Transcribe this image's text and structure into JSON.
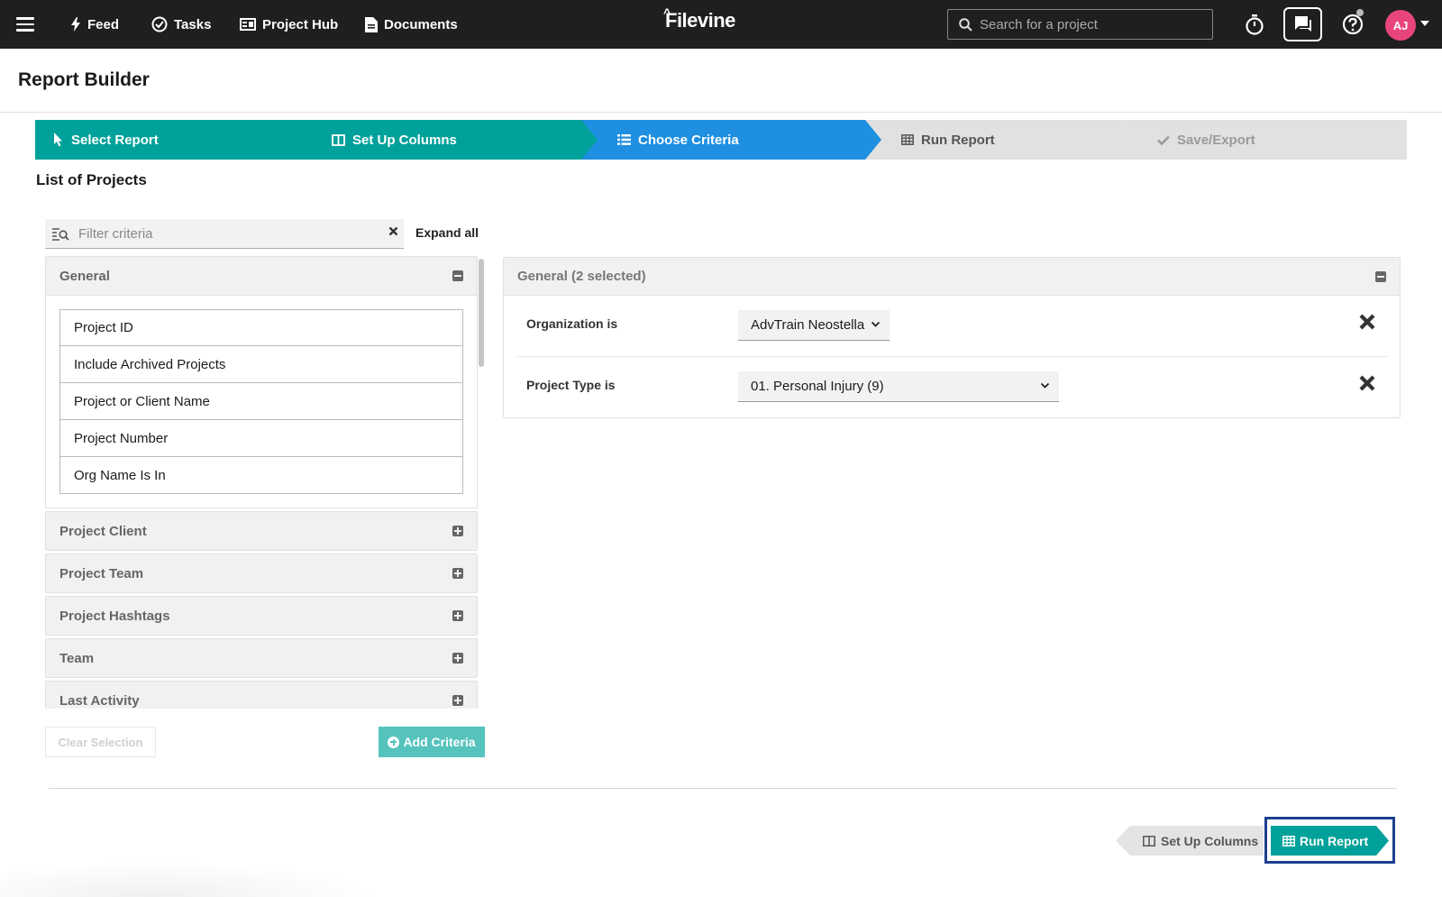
{
  "nav": {
    "items": [
      {
        "label": "Feed",
        "icon": "bolt-icon"
      },
      {
        "label": "Tasks",
        "icon": "check-circle-icon"
      },
      {
        "label": "Project Hub",
        "icon": "project-hub-icon"
      },
      {
        "label": "Documents",
        "icon": "document-icon"
      }
    ],
    "logo": "Filevine",
    "search_placeholder": "Search for a project",
    "avatar_initials": "AJ"
  },
  "page": {
    "title": "Report Builder",
    "section_title": "List of Projects"
  },
  "stepper": {
    "steps": [
      {
        "label": "Select Report",
        "state": "done",
        "icon": "pointer-icon"
      },
      {
        "label": "Set Up Columns",
        "state": "done",
        "icon": "columns-icon"
      },
      {
        "label": "Choose Criteria",
        "state": "active",
        "icon": "list-icon"
      },
      {
        "label": "Run Report",
        "state": "todo",
        "icon": "table-icon"
      },
      {
        "label": "Save/Export",
        "state": "disabled",
        "icon": "check-icon"
      }
    ]
  },
  "criteria_panel": {
    "filter_placeholder": "Filter criteria",
    "expand_all": "Expand all",
    "groups": [
      {
        "label": "General",
        "expanded": true,
        "items": [
          "Project ID",
          "Include Archived Projects",
          "Project or Client Name",
          "Project Number",
          "Org Name Is In"
        ]
      },
      {
        "label": "Project Client",
        "expanded": false
      },
      {
        "label": "Project Team",
        "expanded": false
      },
      {
        "label": "Project Hashtags",
        "expanded": false
      },
      {
        "label": "Team",
        "expanded": false
      },
      {
        "label": "Last Activity",
        "expanded": false
      }
    ],
    "clear_selection": "Clear Selection",
    "add_criteria": "Add Criteria"
  },
  "selected_panel": {
    "header": "General (2 selected)",
    "rows": [
      {
        "label": "Organization is",
        "value": "AdvTrain Neostella"
      },
      {
        "label": "Project Type is",
        "value": "01. Personal Injury (9)"
      }
    ]
  },
  "footer": {
    "back_label": "Set Up Columns",
    "next_label": "Run Report"
  },
  "colors": {
    "teal": "#00a19a",
    "blue": "#1e8fe1",
    "nav_bg": "#1f1f1f",
    "avatar": "#e8447e",
    "highlight_outline": "#1c3f8f"
  }
}
